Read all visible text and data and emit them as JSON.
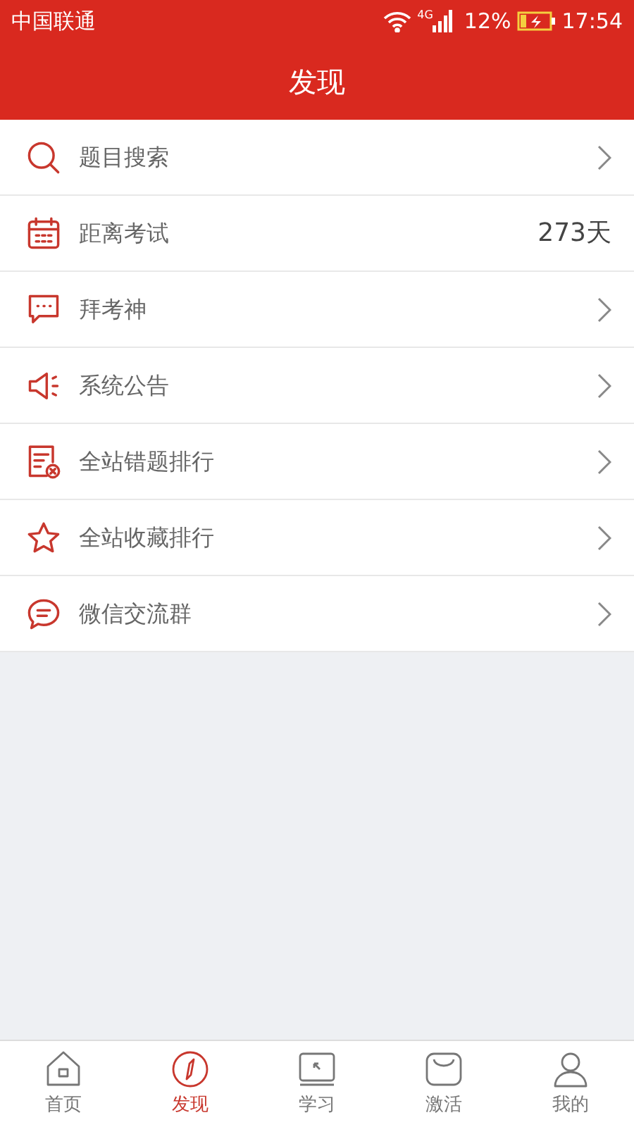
{
  "status_bar": {
    "carrier": "中国联通",
    "network": "4G",
    "battery": "12%",
    "time": "17:54"
  },
  "header": {
    "title": "发现"
  },
  "items": [
    {
      "kind": "link",
      "label": "题目搜索"
    },
    {
      "kind": "value",
      "label": "距离考试",
      "value": "273天"
    },
    {
      "kind": "link",
      "label": "拜考神"
    },
    {
      "kind": "link",
      "label": "系统公告"
    },
    {
      "kind": "link",
      "label": "全站错题排行"
    },
    {
      "kind": "link",
      "label": "全站收藏排行"
    },
    {
      "kind": "link",
      "label": "微信交流群"
    }
  ],
  "tabs": [
    {
      "label": "首页",
      "selected": false
    },
    {
      "label": "发现",
      "selected": true
    },
    {
      "label": "学习",
      "selected": false
    },
    {
      "label": "激活",
      "selected": false
    },
    {
      "label": "我的",
      "selected": false
    }
  ]
}
